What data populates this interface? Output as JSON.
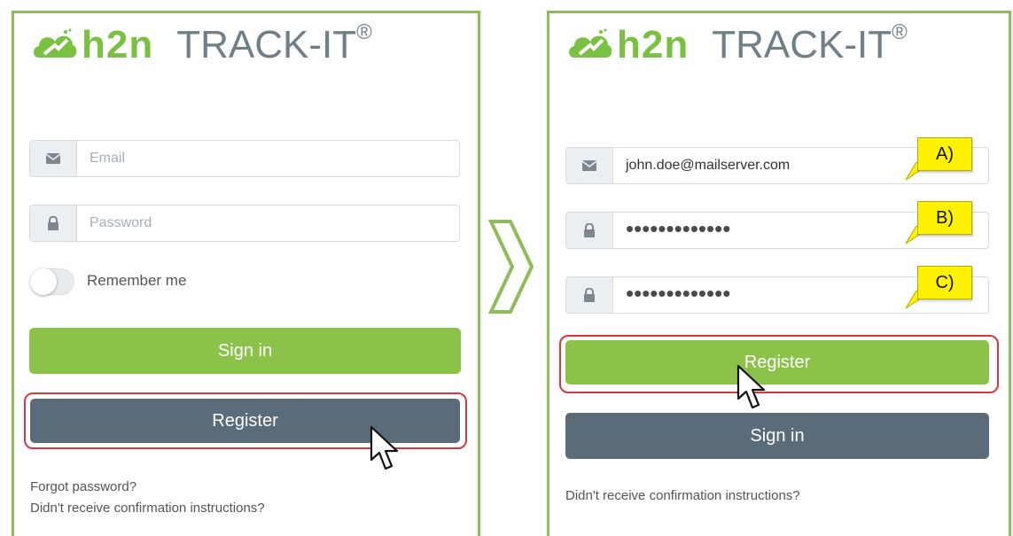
{
  "left": {
    "brand": "h2n",
    "product": "TRACK-IT",
    "reg_mark": "®",
    "email_placeholder": "Email",
    "password_placeholder": "Password",
    "remember_label": "Remember me",
    "signin_label": "Sign in",
    "register_label": "Register",
    "forgot_label": "Forgot password?",
    "confirm_label": "Didn't receive confirmation instructions?"
  },
  "right": {
    "brand": "h2n",
    "product": "TRACK-IT",
    "reg_mark": "®",
    "email_value": "john.doe@mailserver.com",
    "password_masked": "•••••••••••••",
    "confirm_password_masked": "•••••••••••••",
    "register_label": "Register",
    "signin_label": "Sign in",
    "confirm_label": "Didn't receive confirmation instructions?",
    "callouts": [
      "A)",
      "B)",
      "C)"
    ]
  },
  "colors": {
    "panel_border": "#8fbc5a",
    "green_button": "#8bc34a",
    "slate_button": "#5a6b79",
    "highlight": "#d9363e",
    "callout": "#fff200"
  },
  "icons": [
    "envelope-icon",
    "lock-icon",
    "cloud-logo-icon",
    "cursor-icon",
    "chevron-right-icon"
  ]
}
